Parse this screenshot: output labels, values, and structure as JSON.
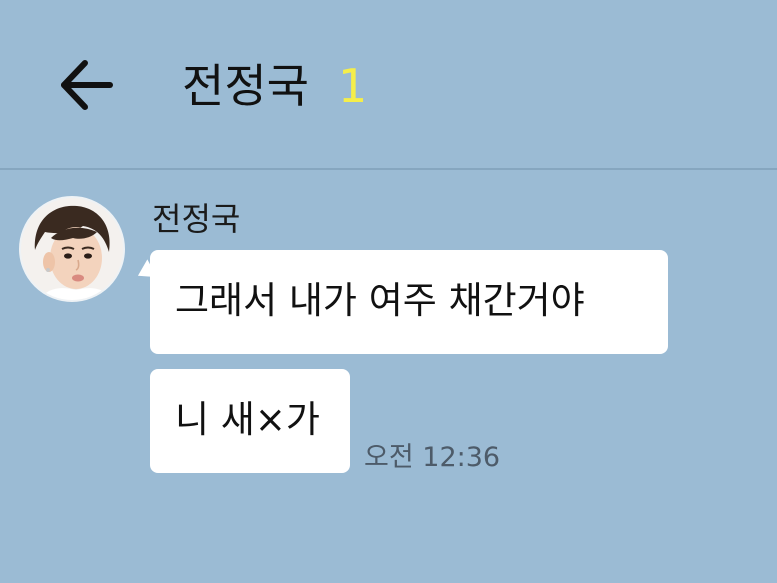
{
  "header": {
    "back_icon": "arrow-left-icon",
    "title": "전정국",
    "member_count": "1",
    "member_count_color": "#f5ee4a"
  },
  "chat": {
    "sender": {
      "name": "전정국",
      "avatar_icon": "avatar-photo"
    },
    "messages": [
      {
        "text": "그래서 내가 여주 채간거야"
      },
      {
        "text": "니 새×가"
      }
    ],
    "timestamp": "오전 12:36"
  },
  "colors": {
    "background": "#9bbbd4",
    "bubble": "#ffffff",
    "text": "#111111"
  }
}
